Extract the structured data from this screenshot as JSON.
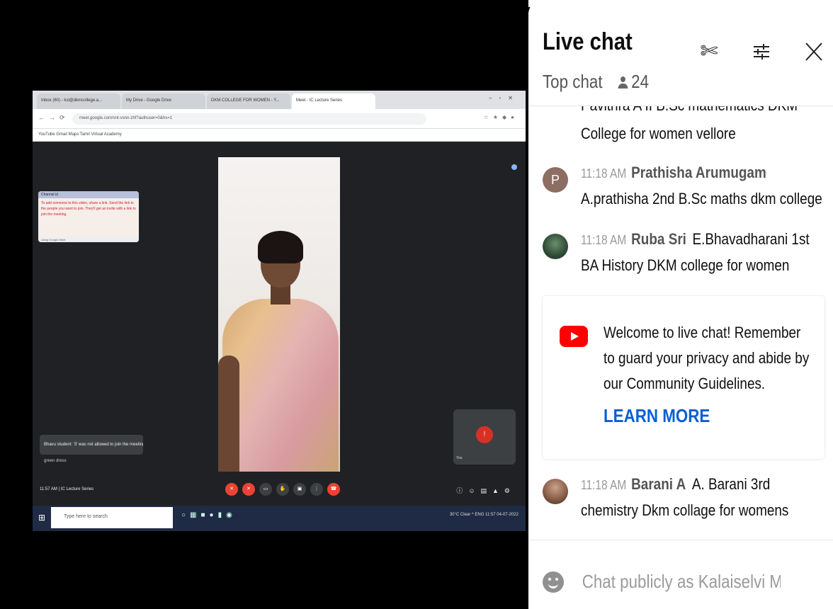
{
  "screen_share": {
    "browser_tabs": [
      "Inbox (60) - ksl@dkmcollege.a...",
      "My Drive - Google Drive",
      "DKM COLLEGE FOR WOMEN - Y...",
      "Meet - IC Lecture Series"
    ],
    "url": "meet.google.com/vnt-vsnn-zhf?authuser=0&hs=1",
    "bookmarks": "YouTube   Gmail   Maps   Tamil Virtual Academy",
    "note_popup": {
      "title": "Channel id",
      "body": "To add someone to this video, share a link. Send the link to the people you want to join. They'll get an invite with a link to join the meeting.",
      "footer": "Using Google Meet"
    },
    "toast": "Bhavu student: '3' was not allowed to join the meeting",
    "toast_sub": "green dress",
    "self_tile_name": "You",
    "meet_time": "11:57 AM  |  IC Lecture Series",
    "taskbar_search": "Type here to search",
    "taskbar_tray": "30°C Clear  ^  ENG  11:57  04-07-2022"
  },
  "chat": {
    "title": "Live chat",
    "mode": "Top chat",
    "viewer_count": "24",
    "partial_message_top": "Pavithra A II B.Sc mathematics DKM",
    "partial_message_bottom": "College for women vellore",
    "messages": [
      {
        "avatar_letter": "P",
        "time": "11:18 AM",
        "author": "Prathisha Arumugam",
        "line1": "A.prathisha 2nd B.Sc maths dkm college",
        "line2": ""
      },
      {
        "avatar_letter": "",
        "time": "11:18 AM",
        "author": "Ruba Sri",
        "line1": "E.Bhavadharani 1st",
        "line2": "BA History DKM college for women"
      },
      {
        "avatar_letter": "",
        "time": "11:18 AM",
        "author": "Barani A",
        "line1": "A. Barani 3rd",
        "line2": "chemistry Dkm collage for womens"
      }
    ],
    "welcome": {
      "text": "Welcome to live chat! Remember to guard your privacy and abide by our Community Guidelines.",
      "learn_more": "LEARN MORE"
    },
    "input_placeholder": "Chat publicly as Kalaiselvi M..."
  }
}
